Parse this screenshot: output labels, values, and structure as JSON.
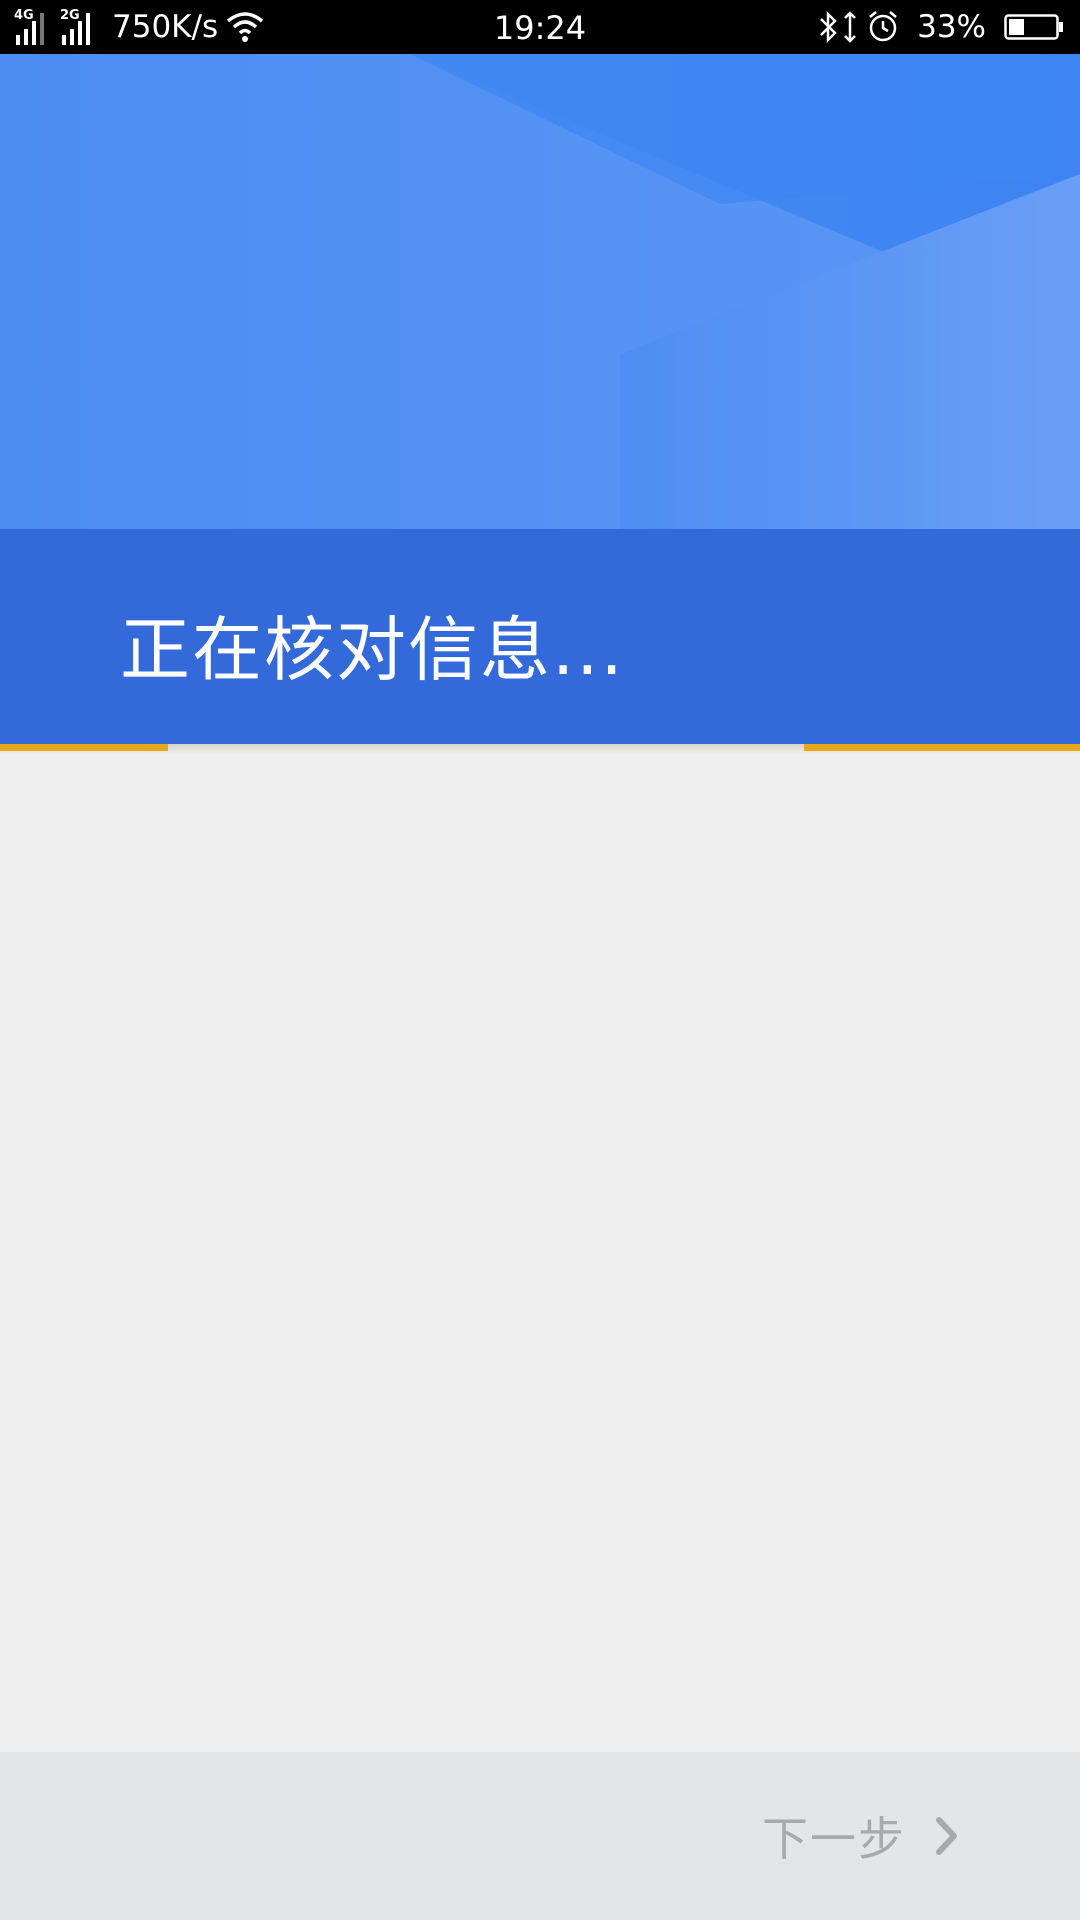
{
  "status_bar": {
    "network_1": "4G",
    "network_2": "2G",
    "speed": "750K/s",
    "time": "19:24",
    "battery_percent": "33%",
    "icons": [
      "signal-icon",
      "wifi-icon",
      "bluetooth-icon",
      "data-transfer-icon",
      "alarm-icon",
      "battery-icon"
    ]
  },
  "header": {
    "title": "正在核对信息...",
    "colors": {
      "top": "#4a8af0",
      "band": "#3369d8",
      "progress": "#e6a817"
    }
  },
  "bottom_bar": {
    "next_label": "下一步",
    "next_icon": "chevron-right-icon"
  }
}
